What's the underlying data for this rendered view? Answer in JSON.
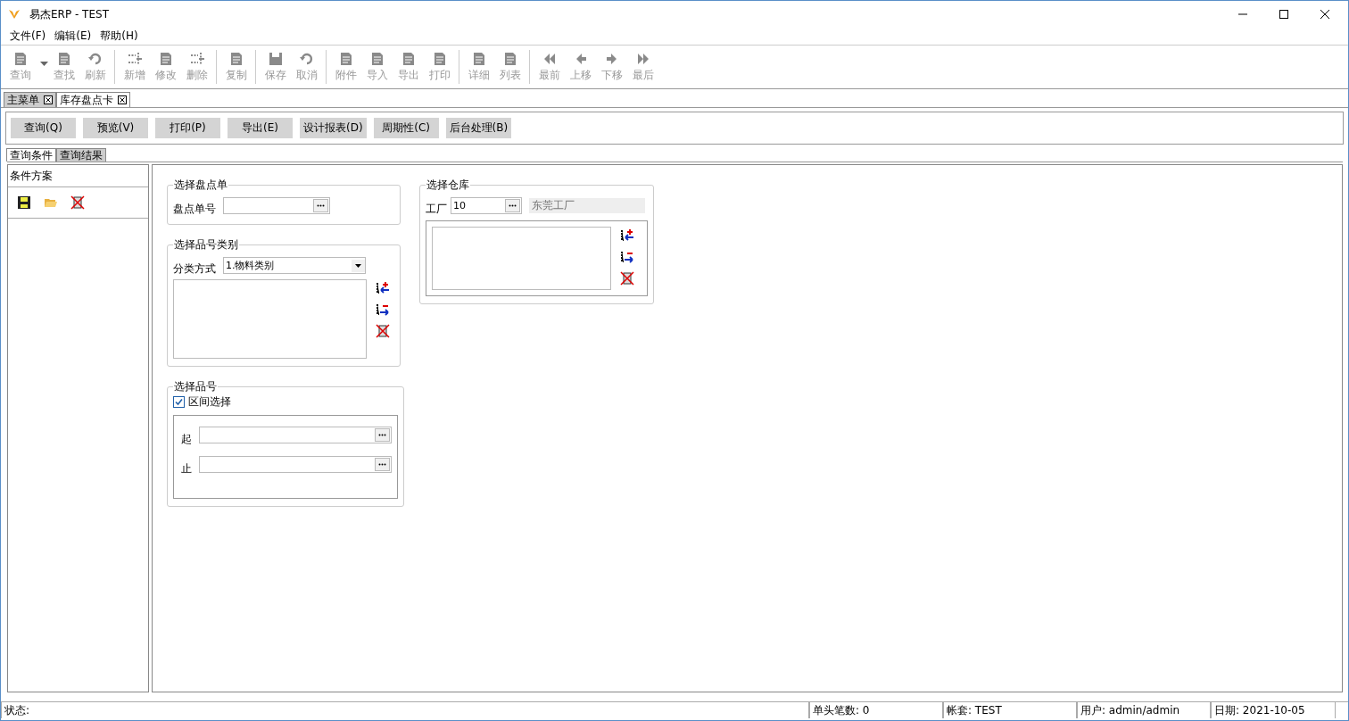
{
  "window": {
    "title": "易杰ERP - TEST"
  },
  "menu": [
    "文件(F)",
    "编辑(E)",
    "帮助(H)"
  ],
  "toolbar": [
    [
      {
        "label": "查询",
        "disabled": true,
        "dropdown": true
      },
      {
        "label": "查找",
        "disabled": true
      },
      {
        "label": "刷新",
        "disabled": true
      }
    ],
    [
      {
        "label": "新增",
        "disabled": true
      },
      {
        "label": "修改",
        "disabled": true
      },
      {
        "label": "删除",
        "disabled": true
      }
    ],
    [
      {
        "label": "复制",
        "disabled": true
      }
    ],
    [
      {
        "label": "保存",
        "disabled": true
      },
      {
        "label": "取消",
        "disabled": true
      }
    ],
    [
      {
        "label": "附件",
        "disabled": true
      },
      {
        "label": "导入",
        "disabled": true
      },
      {
        "label": "导出",
        "disabled": true
      },
      {
        "label": "打印",
        "disabled": true
      }
    ],
    [
      {
        "label": "详细",
        "disabled": true
      },
      {
        "label": "列表",
        "disabled": true
      }
    ],
    [
      {
        "label": "最前",
        "disabled": true
      },
      {
        "label": "上移",
        "disabled": true
      },
      {
        "label": "下移",
        "disabled": true
      },
      {
        "label": "最后",
        "disabled": true
      }
    ]
  ],
  "doc_tabs": [
    {
      "label": "主菜单",
      "selected": false
    },
    {
      "label": "库存盘点卡",
      "selected": true
    }
  ],
  "actions": [
    "查询(Q)",
    "预览(V)",
    "打印(P)",
    "导出(E)",
    "设计报表(D)",
    "周期性(C)",
    "后台处理(B)"
  ],
  "sub_tabs": [
    {
      "label": "查询条件",
      "selected": true
    },
    {
      "label": "查询结果",
      "selected": false
    }
  ],
  "scheme_panel": {
    "title": "条件方案"
  },
  "count_sheet": {
    "title": "选择盘点单",
    "label": "盘点单号"
  },
  "category": {
    "title": "选择品号类别",
    "label": "分类方式",
    "value": "1.物料类别"
  },
  "item": {
    "title": "选择品号",
    "range_label": "区间选择",
    "range_checked": true,
    "from_label": "起",
    "to_label": "止"
  },
  "warehouse": {
    "title": "选择仓库",
    "label": "工厂",
    "value": "10",
    "name": "东莞工厂"
  },
  "status_bar": [
    "状态:",
    "单头笔数: 0",
    "帐套: TEST",
    "用户: admin/admin",
    "日期: 2021-10-05"
  ]
}
